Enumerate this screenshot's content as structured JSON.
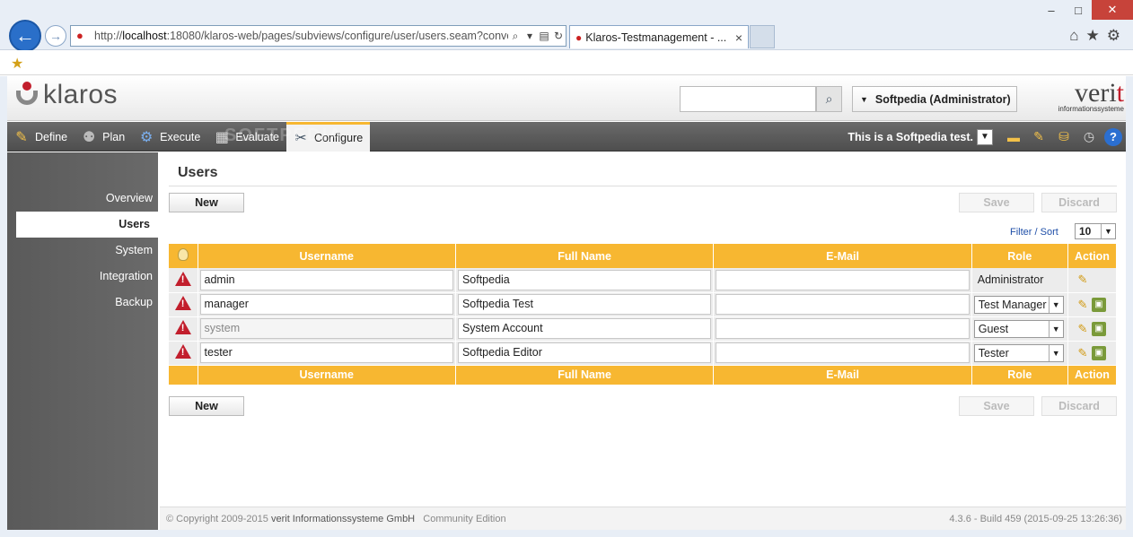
{
  "browser": {
    "url_prefix": "http://",
    "url_host": "localhost",
    "url_rest": ":18080/klaros-web/pages/subviews/configure/user/users.seam?conver",
    "tab_title": "Klaros-Testmanagement - ...",
    "tab_close": "×",
    "back": "←",
    "forward": "→",
    "search_glyph": "⌕",
    "dropdown_glyph": "▾",
    "compat_glyph": "▤",
    "refresh_glyph": "↻",
    "minimize": "–",
    "maximize": "□",
    "close": "✕",
    "home_glyph": "⌂",
    "favorites_glyph": "★",
    "tools_glyph": "⚙",
    "add_fav_glyph": "★"
  },
  "header": {
    "logo_text": "klaros",
    "search_placeholder": "",
    "search_glyph": "⌕",
    "user_menu_caret": "▼",
    "user_menu": "Softpedia (Administrator)",
    "verit_brand_pre": "veri",
    "verit_brand_t": "t",
    "verit_sub": "informationssysteme"
  },
  "nav": {
    "items": [
      {
        "label": "Define",
        "icon": "✎"
      },
      {
        "label": "Plan",
        "icon": "⚉"
      },
      {
        "label": "Execute",
        "icon": "⚙"
      },
      {
        "label": "Evaluate",
        "icon": "▦"
      },
      {
        "label": "Configure",
        "icon": "✂"
      }
    ],
    "project": "This is a Softpedia test.",
    "project_dd": "▼",
    "tool_icons": [
      "▬",
      "✎",
      "⛁",
      "◷"
    ],
    "help": "?"
  },
  "watermark": "SOFTPEDIA",
  "sidebar": {
    "items": [
      "Overview",
      "Users",
      "System",
      "Integration",
      "Backup"
    ]
  },
  "main": {
    "title": "Users",
    "new_label": "New",
    "save_label": "Save",
    "discard_label": "Discard",
    "filter_sort": "Filter / Sort",
    "page_size": "10",
    "page_size_dd": "▼",
    "columns": [
      "Username",
      "Full Name",
      "E-Mail",
      "Role",
      "Action"
    ],
    "rows": [
      {
        "username": "admin",
        "full_name": "Softpedia",
        "email": "",
        "role": "Administrator",
        "role_editable": false,
        "username_readonly": false
      },
      {
        "username": "manager",
        "full_name": "Softpedia Test",
        "email": "",
        "role": "Test Manager",
        "role_editable": true,
        "username_readonly": false
      },
      {
        "username": "system",
        "full_name": "System Account",
        "email": "",
        "role": "Guest",
        "role_editable": true,
        "username_readonly": true
      },
      {
        "username": "tester",
        "full_name": "Softpedia Editor",
        "email": "",
        "role": "Tester",
        "role_editable": true,
        "username_readonly": false
      }
    ],
    "role_dd": "▼",
    "edit_icon": "✎",
    "archive_icon": "▣"
  },
  "footer": {
    "copyright_prefix": "© Copyright 2009-2015",
    "company": "verit Informationssysteme GmbH",
    "edition": "Community Edition",
    "build": "4.3.6 - Build 459 (2015-09-25 13:26:36)"
  },
  "colors": {
    "accent": "#f7b731",
    "nav_bg": "#555555",
    "warning": "#c21e2c"
  }
}
